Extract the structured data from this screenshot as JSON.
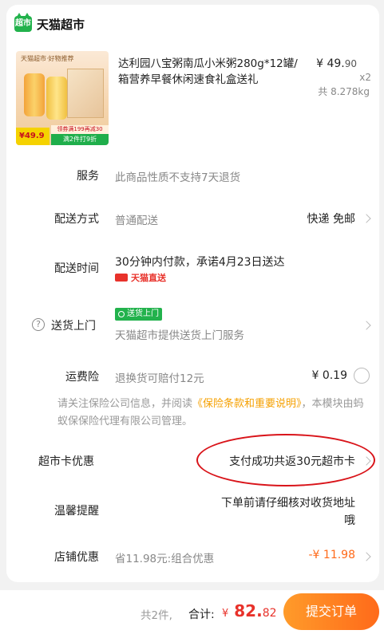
{
  "store": {
    "badge": "超市",
    "name": "天猫超市"
  },
  "product": {
    "image_top_text": "天猫超市·好物推荐",
    "image_price": "¥49.9",
    "image_promo_1": "领券满199再减30",
    "image_promo_2": "满2件打9折",
    "title": "达利园八宝粥南瓜小米粥280g*12罐/箱营养早餐休闲速食礼盒送礼",
    "price_main": "¥ 49.",
    "price_cents": "90",
    "quantity": "x2",
    "weight": "共 8.278kg"
  },
  "service": {
    "label": "服务",
    "value": "此商品性质不支持7天退货"
  },
  "delivery": {
    "label": "配送方式",
    "value": "普通配送",
    "option": "快递 免邮"
  },
  "delivery_time": {
    "label": "配送时间",
    "value": "30分钟内付款，承诺4月23日送达",
    "tag": "天猫直送"
  },
  "door_delivery": {
    "label": "送货上门",
    "help_icon": "?",
    "tag": "送货上门",
    "value": "天猫超市提供送货上门服务"
  },
  "freight_insurance": {
    "label": "运费险",
    "value": "退换货可赔付12元",
    "price": "¥ 0.19"
  },
  "insurance_note": {
    "text_1": "请关注保险公司信息，并阅读",
    "link": "《保险条款和重要说明》",
    "text_2": "，本模块由蚂蚁保保险代理有限公司管理。"
  },
  "supermarket_card": {
    "label": "超市卡优惠",
    "value": "支付成功共返30元超市卡"
  },
  "reminder": {
    "label": "温馨提醒",
    "value_line1": "下单前请仔细核对收货地址",
    "value_line2": "哦"
  },
  "store_discount": {
    "label": "店铺优惠",
    "value": "省11.98元:组合优惠",
    "amount": "-¥ 11.98"
  },
  "bottom_bar": {
    "count": "共2件,",
    "total_label": "合计:",
    "total_symbol": "¥",
    "total_main": " 82.",
    "total_cents": "82",
    "submit": "提交订单"
  },
  "colors": {
    "accent": "#e8322b",
    "green": "#22b24c",
    "orange": "#ff7a1a",
    "warning": "#f5a000"
  }
}
